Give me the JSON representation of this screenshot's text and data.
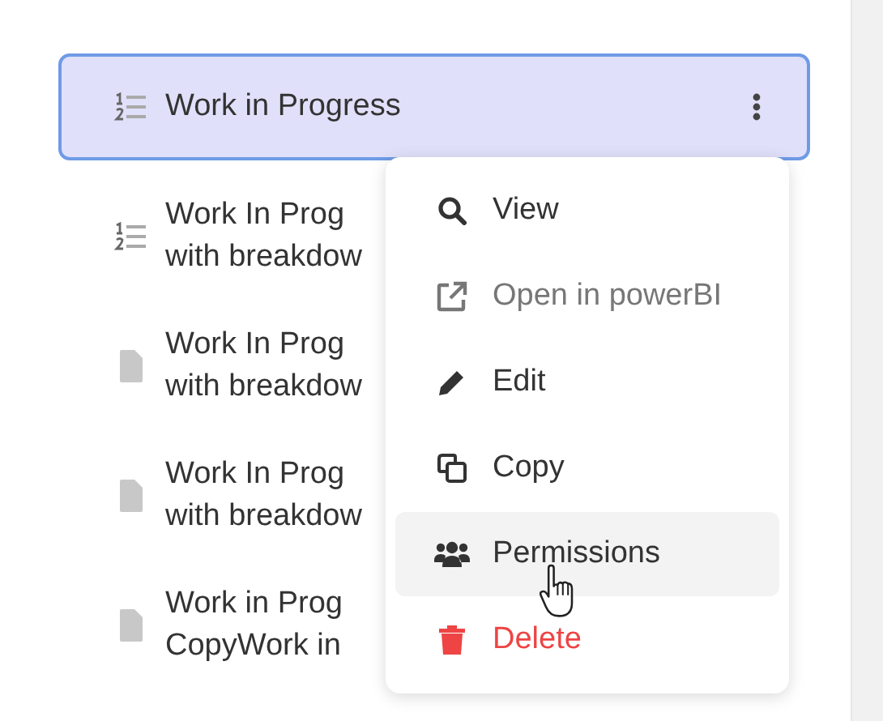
{
  "reports": [
    {
      "kind": "list",
      "lines": [
        "Work in Progress"
      ],
      "selected": true
    },
    {
      "kind": "list",
      "lines": [
        "Work In Prog",
        "with breakdow"
      ],
      "selected": false
    },
    {
      "kind": "file",
      "lines": [
        "Work In Prog",
        "with breakdow"
      ],
      "selected": false
    },
    {
      "kind": "file",
      "lines": [
        "Work In Prog",
        "with breakdow"
      ],
      "selected": false
    },
    {
      "kind": "file",
      "lines": [
        "Work in Prog",
        "CopyWork in"
      ],
      "selected": false
    }
  ],
  "context_menu": [
    {
      "kind": "search",
      "label": "View",
      "disabled": false,
      "hovered": false,
      "danger": false
    },
    {
      "kind": "external",
      "label": "Open in powerBI",
      "disabled": true,
      "hovered": false,
      "danger": false
    },
    {
      "kind": "pencil",
      "label": "Edit",
      "disabled": false,
      "hovered": false,
      "danger": false
    },
    {
      "kind": "copy",
      "label": "Copy",
      "disabled": false,
      "hovered": false,
      "danger": false
    },
    {
      "kind": "users",
      "label": "Permissions",
      "disabled": false,
      "hovered": true,
      "danger": false
    },
    {
      "kind": "trash",
      "label": "Delete",
      "disabled": false,
      "hovered": false,
      "danger": true
    }
  ]
}
